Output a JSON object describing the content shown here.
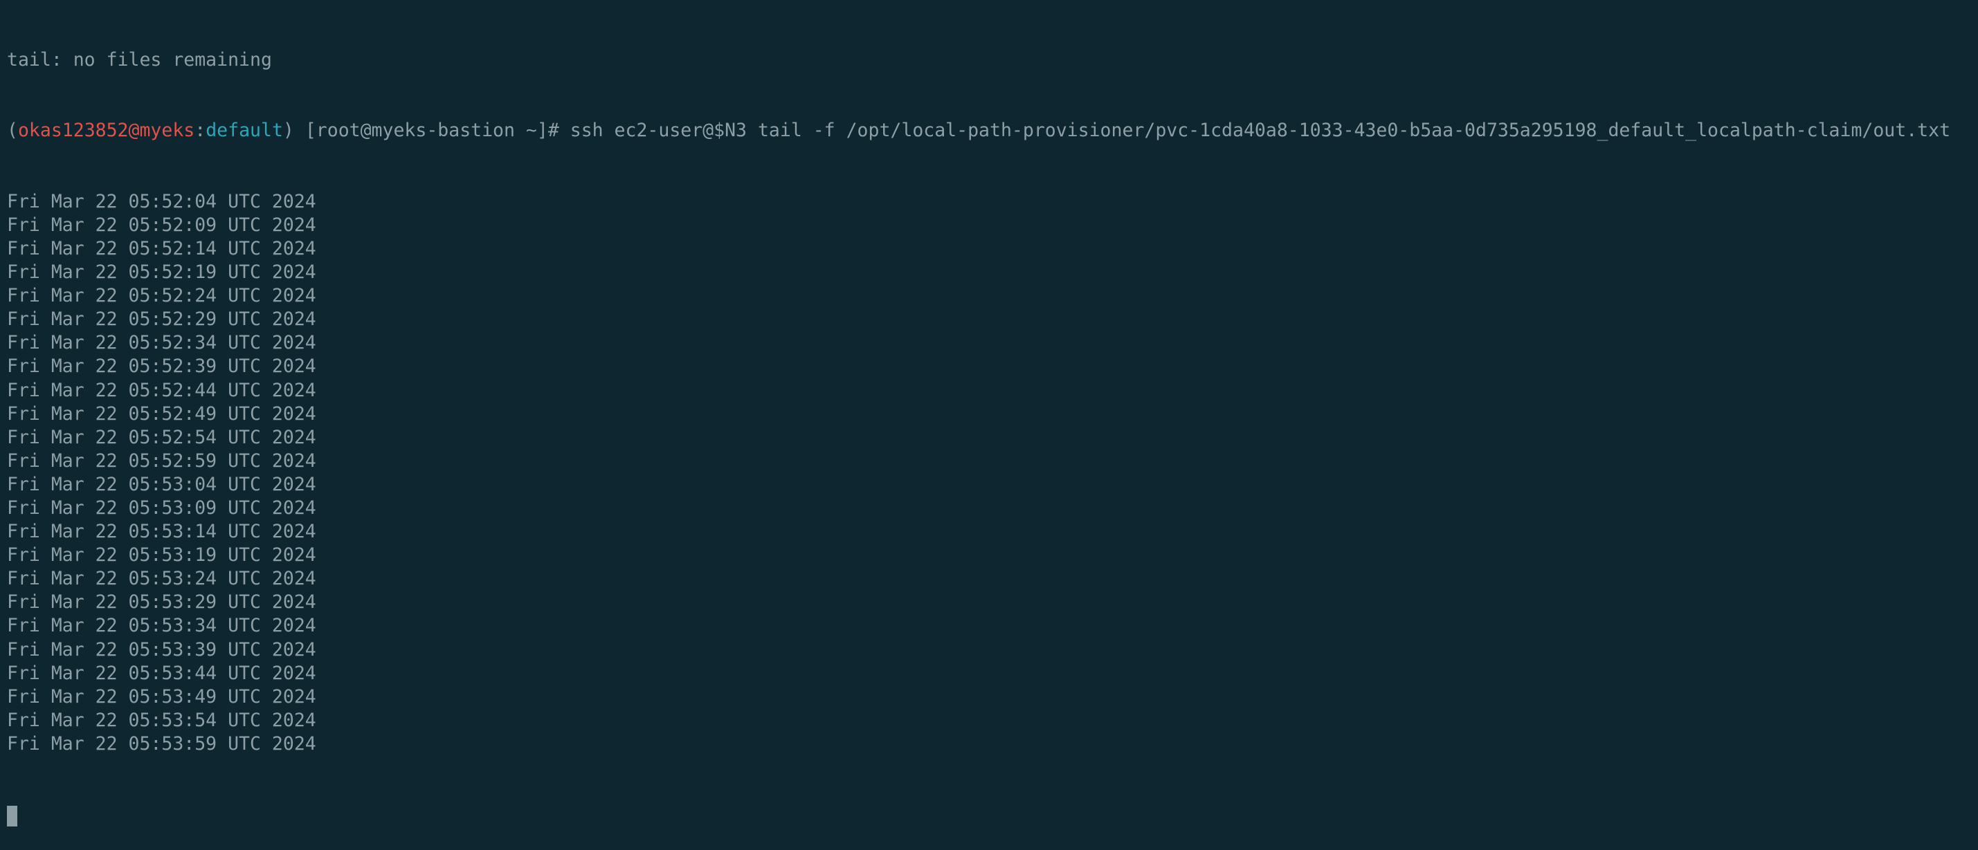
{
  "terminal": {
    "first_line": "tail: no files remaining",
    "prompt": {
      "open": "(",
      "user_host": "okas123852@myeks",
      "colon": ":",
      "namespace": "default",
      "close": ") ",
      "rest": "[root@myeks-bastion ~]# ",
      "command": "ssh ec2-user@$N3 tail -f /opt/local-path-provisioner/pvc-1cda40a8-1033-43e0-b5aa-0d735a295198_default_localpath-claim/out.txt"
    },
    "output": [
      "Fri Mar 22 05:52:04 UTC 2024",
      "Fri Mar 22 05:52:09 UTC 2024",
      "Fri Mar 22 05:52:14 UTC 2024",
      "Fri Mar 22 05:52:19 UTC 2024",
      "Fri Mar 22 05:52:24 UTC 2024",
      "Fri Mar 22 05:52:29 UTC 2024",
      "Fri Mar 22 05:52:34 UTC 2024",
      "Fri Mar 22 05:52:39 UTC 2024",
      "Fri Mar 22 05:52:44 UTC 2024",
      "Fri Mar 22 05:52:49 UTC 2024",
      "Fri Mar 22 05:52:54 UTC 2024",
      "Fri Mar 22 05:52:59 UTC 2024",
      "Fri Mar 22 05:53:04 UTC 2024",
      "Fri Mar 22 05:53:09 UTC 2024",
      "Fri Mar 22 05:53:14 UTC 2024",
      "Fri Mar 22 05:53:19 UTC 2024",
      "Fri Mar 22 05:53:24 UTC 2024",
      "Fri Mar 22 05:53:29 UTC 2024",
      "Fri Mar 22 05:53:34 UTC 2024",
      "Fri Mar 22 05:53:39 UTC 2024",
      "Fri Mar 22 05:53:44 UTC 2024",
      "Fri Mar 22 05:53:49 UTC 2024",
      "Fri Mar 22 05:53:54 UTC 2024",
      "Fri Mar 22 05:53:59 UTC 2024"
    ]
  },
  "colors": {
    "background": "#0e2630",
    "text": "#8d9fa5",
    "prompt_user": "#e0524a",
    "prompt_namespace": "#2aa7b8"
  }
}
